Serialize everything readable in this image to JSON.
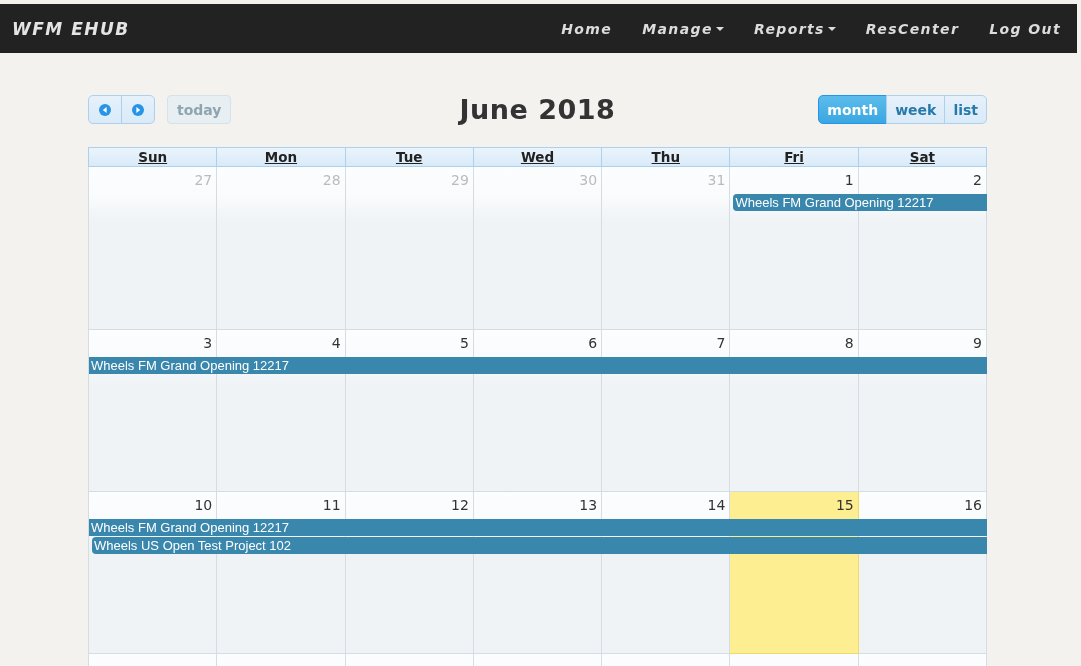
{
  "navbar": {
    "brand": "WFM EHUB",
    "items": [
      {
        "label": "Home",
        "dropdown": false
      },
      {
        "label": "Manage",
        "dropdown": true
      },
      {
        "label": "Reports",
        "dropdown": true
      },
      {
        "label": "ResCenter",
        "dropdown": false
      },
      {
        "label": "Log Out",
        "dropdown": false
      }
    ]
  },
  "toolbar": {
    "today": {
      "label": "today",
      "disabled": true
    },
    "title": "June 2018",
    "views": [
      {
        "label": "month",
        "selected": true
      },
      {
        "label": "week",
        "selected": false
      },
      {
        "label": "list",
        "selected": false
      }
    ]
  },
  "calendar": {
    "day_headers": [
      "Sun",
      "Mon",
      "Tue",
      "Wed",
      "Thu",
      "Fri",
      "Sat"
    ],
    "weeks": [
      {
        "days": [
          {
            "number": "27",
            "other_month": true,
            "today": false
          },
          {
            "number": "28",
            "other_month": true,
            "today": false
          },
          {
            "number": "29",
            "other_month": true,
            "today": false
          },
          {
            "number": "30",
            "other_month": true,
            "today": false
          },
          {
            "number": "31",
            "other_month": true,
            "today": false
          },
          {
            "number": "1",
            "other_month": false,
            "today": false,
            "events": [
              {
                "title": "Wheels FM Grand Opening 12217",
                "continues_before": false,
                "continues_after": true
              }
            ]
          },
          {
            "number": "2",
            "other_month": false,
            "today": false
          }
        ]
      },
      {
        "days": [
          {
            "number": "3",
            "other_month": false,
            "today": false,
            "events": [
              {
                "title": "Wheels FM Grand Opening 12217",
                "continues_before": true,
                "continues_after": true
              }
            ]
          },
          {
            "number": "4",
            "other_month": false,
            "today": false
          },
          {
            "number": "5",
            "other_month": false,
            "today": false
          },
          {
            "number": "6",
            "other_month": false,
            "today": false
          },
          {
            "number": "7",
            "other_month": false,
            "today": false
          },
          {
            "number": "8",
            "other_month": false,
            "today": false
          },
          {
            "number": "9",
            "other_month": false,
            "today": false
          }
        ]
      },
      {
        "days": [
          {
            "number": "10",
            "other_month": false,
            "today": false,
            "events": [
              {
                "title": "Wheels FM Grand Opening 12217",
                "continues_before": true,
                "continues_after": true
              },
              {
                "title": "Wheels US Open Test Project 102",
                "continues_before": false,
                "continues_after": true
              }
            ]
          },
          {
            "number": "11",
            "other_month": false,
            "today": false
          },
          {
            "number": "12",
            "other_month": false,
            "today": false
          },
          {
            "number": "13",
            "other_month": false,
            "today": false
          },
          {
            "number": "14",
            "other_month": false,
            "today": false
          },
          {
            "number": "15",
            "other_month": false,
            "today": true
          },
          {
            "number": "16",
            "other_month": false,
            "today": false
          }
        ]
      }
    ]
  }
}
